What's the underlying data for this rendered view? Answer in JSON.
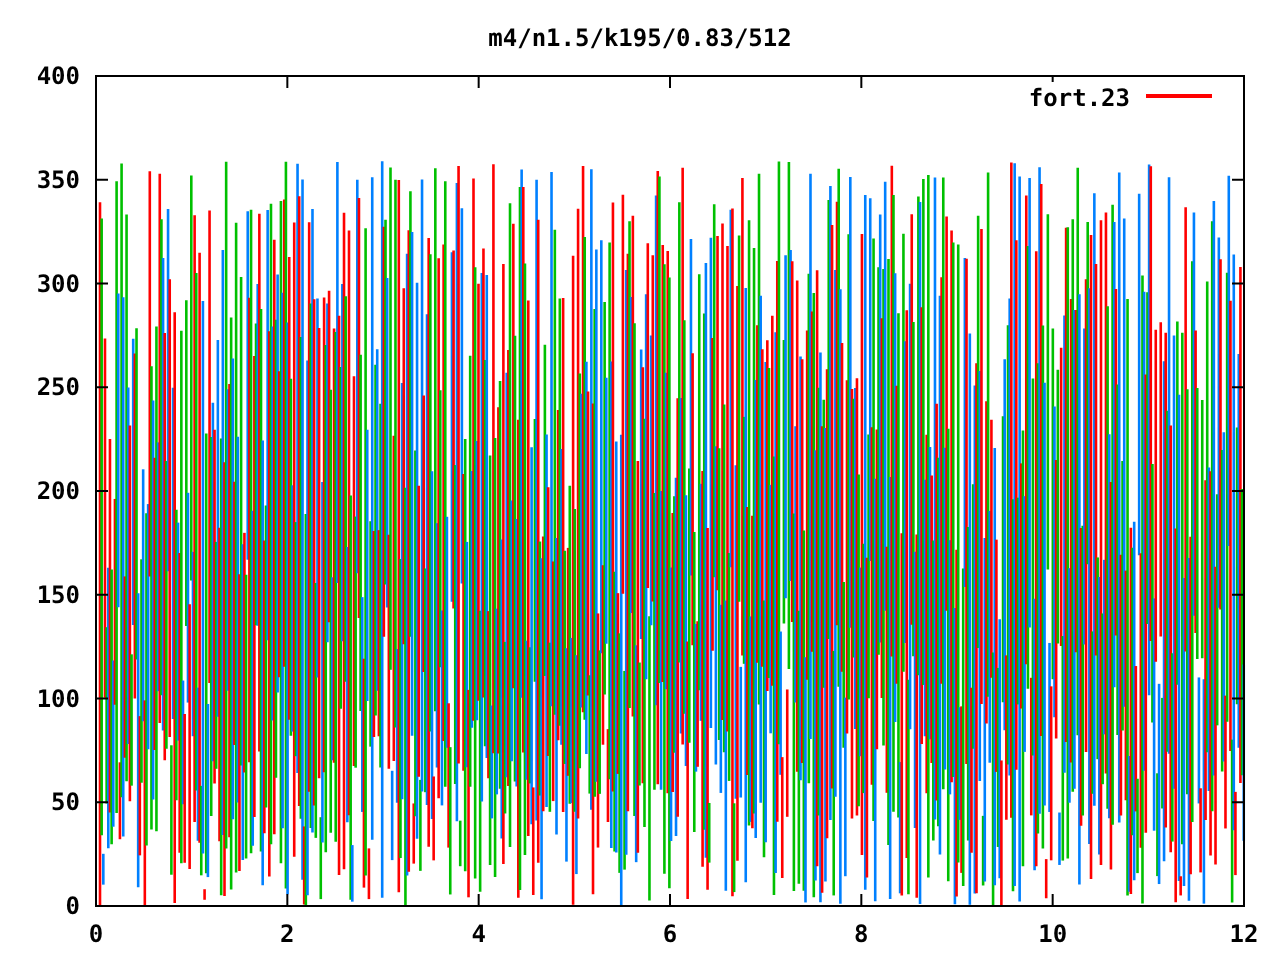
{
  "plot": {
    "title": "m4/n1.5/k195/0.83/512",
    "legend": {
      "label": "fort.23",
      "color": "#ff0000"
    },
    "xticks": [
      "0",
      "2",
      "4",
      "6",
      "8",
      "10",
      "12"
    ],
    "yticks": [
      "400",
      "350",
      "300",
      "250",
      "200",
      "150",
      "100",
      "50",
      "0"
    ]
  }
}
